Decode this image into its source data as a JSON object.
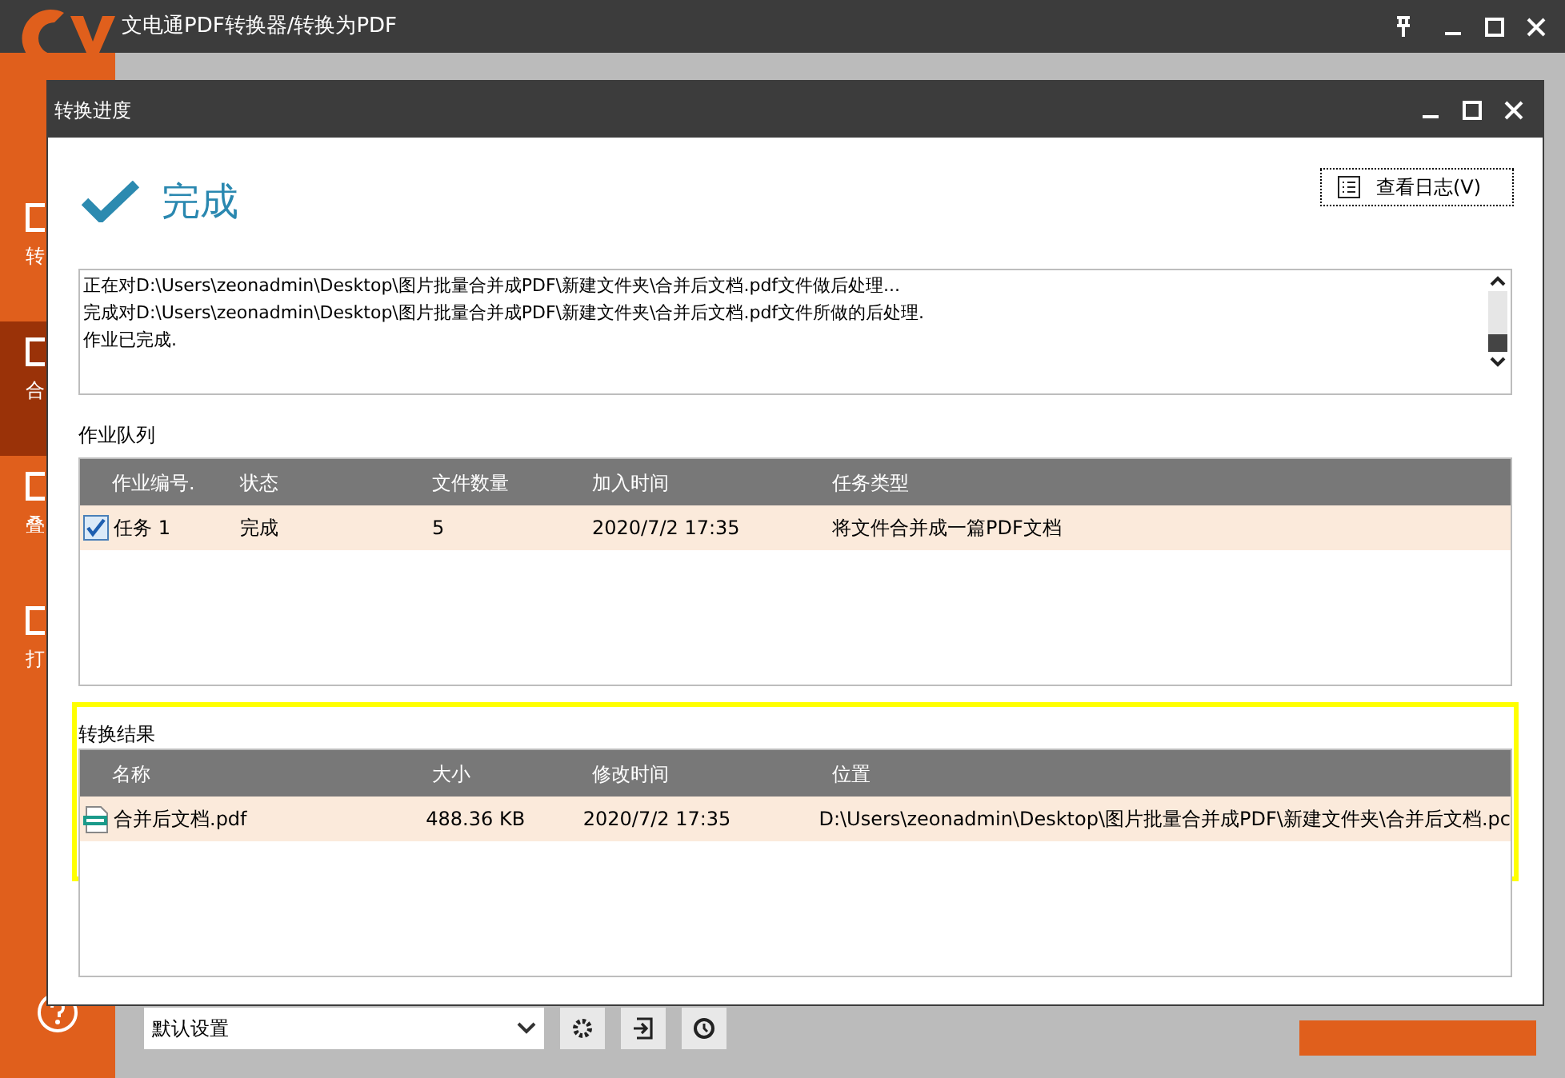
{
  "app": {
    "title": "文电通PDF转换器/转换为PDF",
    "sidebar": [
      {
        "label": "转",
        "selected": false
      },
      {
        "label": "合",
        "selected": true
      },
      {
        "label": "叠",
        "selected": false
      },
      {
        "label": "打",
        "selected": false
      }
    ],
    "profile": {
      "value": "默认设置"
    }
  },
  "dialog": {
    "title": "转换进度",
    "status": "完成",
    "log_button": "查看日志(V)",
    "log": [
      "正在对D:\\Users\\zeonadmin\\Desktop\\图片批量合并成PDF\\新建文件夹\\合并后文档.pdf文件做后处理...",
      "完成对D:\\Users\\zeonadmin\\Desktop\\图片批量合并成PDF\\新建文件夹\\合并后文档.pdf文件所做的后处理.",
      "作业已完成."
    ],
    "queue": {
      "label": "作业队列",
      "columns": [
        "作业编号.",
        "状态",
        "文件数量",
        "加入时间",
        "任务类型"
      ],
      "rows": [
        {
          "checked": true,
          "cells": [
            "任务 1",
            "完成",
            "5",
            "2020/7/2 17:35",
            "将文件合并成一篇PDF文档"
          ]
        }
      ]
    },
    "results": {
      "label": "转换结果",
      "columns": [
        "名称",
        "大小",
        "修改时间",
        "位置"
      ],
      "rows": [
        {
          "cells": [
            "合并后文档.pdf",
            "488.36 KB",
            "2020/7/2 17:35",
            "D:\\Users\\zeonadmin\\Desktop\\图片批量合并成PDF\\新建文件夹\\合并后文档.pc"
          ]
        }
      ]
    }
  }
}
